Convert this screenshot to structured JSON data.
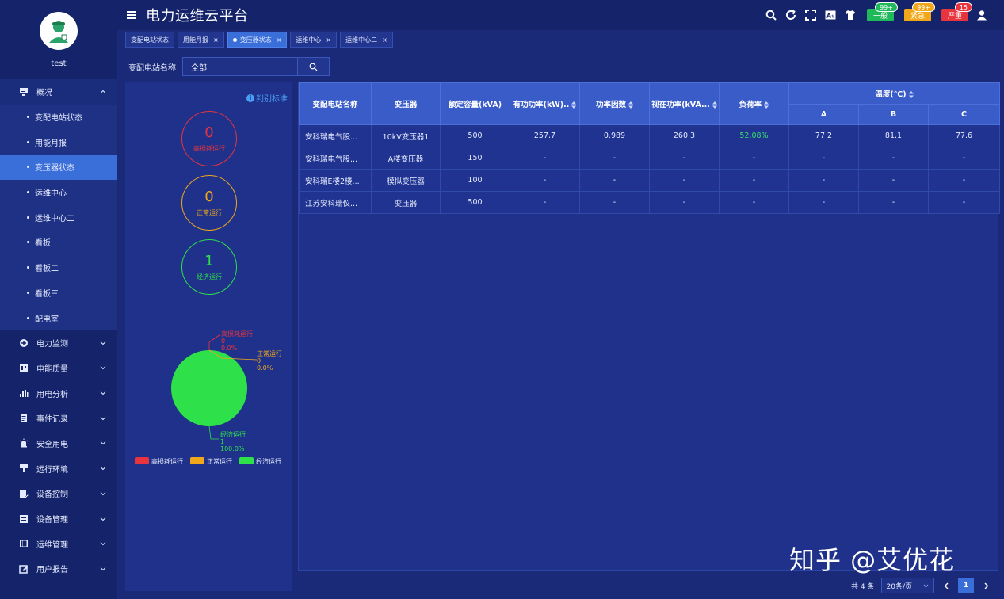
{
  "sidebar": {
    "user": "test",
    "overview": {
      "label": "概况",
      "icon": "monitor-icon"
    },
    "sub_items": [
      {
        "label": "变配电站状态"
      },
      {
        "label": "用能月报"
      },
      {
        "label": "变压器状态"
      },
      {
        "label": "运维中心"
      },
      {
        "label": "运维中心二"
      },
      {
        "label": "看板"
      },
      {
        "label": "看板二"
      },
      {
        "label": "看板三"
      },
      {
        "label": "配电室"
      }
    ],
    "menu": [
      {
        "label": "电力监测",
        "icon": "plus-circle-icon"
      },
      {
        "label": "电能质量",
        "icon": "building-icon"
      },
      {
        "label": "用电分析",
        "icon": "bar-chart-icon"
      },
      {
        "label": "事件记录",
        "icon": "document-icon"
      },
      {
        "label": "安全用电",
        "icon": "alarm-light-icon"
      },
      {
        "label": "运行环境",
        "icon": "flag-icon"
      },
      {
        "label": "设备控制",
        "icon": "edit-doc-icon"
      },
      {
        "label": "设备管理",
        "icon": "grid-doc-icon"
      },
      {
        "label": "运维管理",
        "icon": "panel-icon"
      },
      {
        "label": "用户报告",
        "icon": "pencil-box-icon"
      }
    ]
  },
  "header": {
    "title": "电力运维云平台",
    "alerts": [
      {
        "label": "一般",
        "count": "99+",
        "color": "#1fb85a",
        "count_color": "#1fb85a"
      },
      {
        "label": "紧急",
        "count": "99+",
        "color": "#f0a81a",
        "count_color": "#f0a81a"
      },
      {
        "label": "严重",
        "count": "15",
        "color": "#e8343e",
        "count_color": "#e8343e"
      }
    ]
  },
  "tabs": [
    {
      "label": "变配电站状态",
      "closable": false,
      "active": false
    },
    {
      "label": "用能月报",
      "closable": true,
      "active": false
    },
    {
      "label": "变压器状态",
      "closable": true,
      "active": true
    },
    {
      "label": "运维中心",
      "closable": true,
      "active": false
    },
    {
      "label": "运维中心二",
      "closable": true,
      "active": false
    }
  ],
  "filter": {
    "label": "变配电站名称",
    "value": "全部"
  },
  "left_panel": {
    "criteria_label": "判别标准",
    "circles": [
      {
        "value": "0",
        "label": "高损耗运行",
        "color": "#e8343e"
      },
      {
        "value": "0",
        "label": "正常运行",
        "color": "#f0a81a"
      },
      {
        "value": "1",
        "label": "经济运行",
        "color": "#2ee04a"
      }
    ],
    "pie": {
      "slices": [
        {
          "name": "高损耗运行",
          "value": "0",
          "percent": "0.0%",
          "color": "#e8343e"
        },
        {
          "name": "正常运行",
          "value": "0",
          "percent": "0.0%",
          "color": "#f0a81a"
        },
        {
          "name": "经济运行",
          "value": "1",
          "percent": "100.0%",
          "color": "#2ee04a"
        }
      ]
    }
  },
  "table": {
    "headers": {
      "station": "变配电站名称",
      "transformer": "变压器",
      "capacity": "额定容量(kVA)",
      "active_power": "有功功率(kW)..",
      "power_factor": "功率因数",
      "apparent_power": "视在功率(kVA...",
      "load_rate": "负荷率",
      "temperature": "温度(℃)",
      "a": "A",
      "b": "B",
      "c": "C"
    },
    "rows": [
      [
        "安科瑞电气股...",
        "10kV变压器1",
        "500",
        "257.7",
        "0.989",
        "260.3",
        "52.08%",
        "77.2",
        "81.1",
        "77.6"
      ],
      [
        "安科瑞电气股...",
        "A楼变压器",
        "150",
        "-",
        "-",
        "-",
        "-",
        "-",
        "-",
        "-"
      ],
      [
        "安科瑞E楼2楼...",
        "模拟变压器",
        "100",
        "-",
        "-",
        "-",
        "-",
        "-",
        "-",
        "-"
      ],
      [
        "江苏安科瑞仪...",
        "变压器",
        "500",
        "-",
        "-",
        "-",
        "-",
        "-",
        "-",
        "-"
      ]
    ]
  },
  "pager": {
    "total": "共 4 条",
    "page_size": "20条/页",
    "current": "1"
  },
  "watermark": "知乎 @艾优花"
}
